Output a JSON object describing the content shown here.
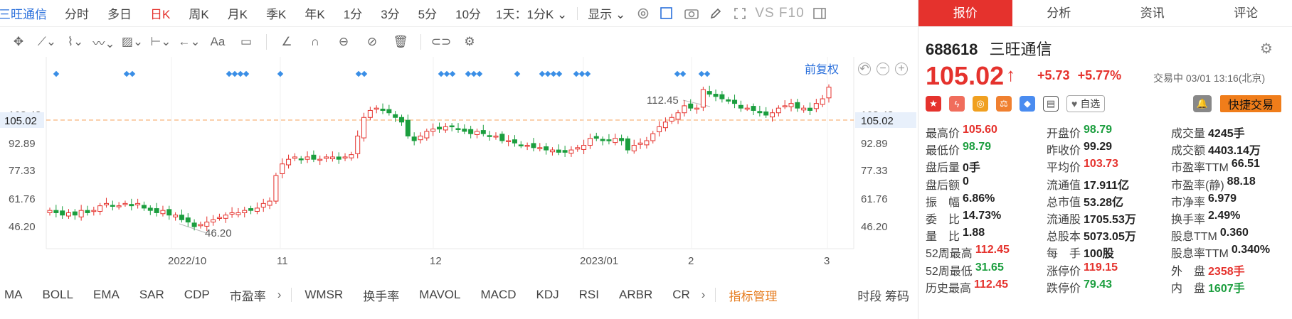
{
  "toolbar": {
    "stock_name": "三旺通信",
    "periods": [
      "分时",
      "多日",
      "日K",
      "周K",
      "月K",
      "季K",
      "年K",
      "1分",
      "3分",
      "5分",
      "10分"
    ],
    "active_period": "日K",
    "interval_select": "1天：1分K",
    "display_label": "显示",
    "vs_f10": "VS F10"
  },
  "chart": {
    "adjust_label": "前复权",
    "current_price_tag": "105.02",
    "max_annotation": "112.45",
    "min_annotation": "46.20",
    "y_ticks": [
      "108.43",
      "92.89",
      "77.33",
      "61.76",
      "46.20"
    ],
    "x_labels": [
      "2022/10",
      "11",
      "12",
      "2023/01",
      "2",
      "3"
    ]
  },
  "chart_data": {
    "type": "candlestick",
    "x_ticks": [
      "2022/10",
      "11",
      "12",
      "2023/01",
      "2",
      "3"
    ],
    "y_ticks": [
      46.2,
      61.76,
      77.33,
      92.89
    ],
    "ylim": [
      38,
      115
    ],
    "current_price": 105.02,
    "annotations": [
      {
        "label": "112.45",
        "kind": "high"
      },
      {
        "label": "46.20",
        "kind": "low"
      }
    ],
    "closes": [
      52,
      51,
      50,
      51,
      50,
      52,
      51,
      52,
      54,
      55,
      54,
      54,
      55,
      54,
      55,
      53,
      52,
      51,
      52,
      50,
      50,
      48,
      47,
      45,
      46,
      47,
      48,
      49,
      50,
      51,
      51,
      52,
      52,
      53,
      55,
      56,
      67,
      72,
      74,
      75,
      74,
      75,
      74,
      74,
      75,
      75,
      74,
      75,
      76,
      84,
      92,
      95,
      96,
      95,
      94,
      92,
      90,
      84,
      82,
      84,
      86,
      87,
      87,
      88,
      88,
      87,
      86,
      85,
      86,
      85,
      84,
      84,
      82,
      82,
      81,
      80,
      80,
      79,
      79,
      78,
      78,
      77,
      77,
      78,
      79,
      80,
      83,
      83,
      82,
      82,
      83,
      82,
      78,
      80,
      81,
      82,
      85,
      88,
      90,
      92,
      94,
      97,
      96,
      96,
      104,
      102,
      101,
      100,
      99,
      98,
      96,
      96,
      95,
      94,
      93,
      94,
      96,
      97,
      98,
      96,
      96,
      95,
      98,
      100,
      105
    ]
  },
  "indicators": {
    "items": [
      "MA",
      "BOLL",
      "EMA",
      "SAR",
      "CDP",
      "市盈率"
    ],
    "items2": [
      "WMSR",
      "换手率",
      "MAVOL",
      "MACD",
      "KDJ",
      "RSI",
      "ARBR",
      "CR"
    ],
    "manager": "指标管理",
    "right": "时段 筹码"
  },
  "panel": {
    "tabs": [
      "报价",
      "分析",
      "资讯",
      "评论"
    ],
    "code": "688618",
    "name": "三旺通信",
    "price": "105.02",
    "arrow": "↑",
    "change": "+5.73",
    "change_pct": "+5.77%",
    "status": "交易中 03/01 13:16(北京)",
    "watch_label": "自选",
    "quick_trade": "快捷交易",
    "rows": [
      [
        [
          "最高价",
          "105.60",
          "red"
        ],
        [
          "开盘价",
          "98.79",
          "green"
        ],
        [
          "成交量",
          "4245手",
          ""
        ]
      ],
      [
        [
          "最低价",
          "98.79",
          "green"
        ],
        [
          "昨收价",
          "99.29",
          ""
        ],
        [
          "成交额",
          "4403.14万",
          ""
        ]
      ],
      [
        [
          "盘后量",
          "0手",
          ""
        ],
        [
          "平均价",
          "103.73",
          "red"
        ],
        [
          "市盈率TTM",
          "66.51",
          ""
        ]
      ],
      [
        [
          "盘后额",
          "0",
          ""
        ],
        [
          "流通值",
          "17.911亿",
          ""
        ],
        [
          "市盈率(静)",
          "88.18",
          ""
        ]
      ],
      [
        [
          "振　幅",
          "6.86%",
          ""
        ],
        [
          "总市值",
          "53.28亿",
          ""
        ],
        [
          "市净率",
          "6.979",
          ""
        ]
      ],
      [
        [
          "委　比",
          "14.73%",
          ""
        ],
        [
          "流通股",
          "1705.53万",
          ""
        ],
        [
          "换手率",
          "2.49%",
          ""
        ]
      ],
      [
        [
          "量　比",
          "1.88",
          ""
        ],
        [
          "总股本",
          "5073.05万",
          ""
        ],
        [
          "股息TTM",
          "0.360",
          ""
        ]
      ],
      [
        [
          "52周最高",
          "112.45",
          "red"
        ],
        [
          "每　手",
          "100股",
          ""
        ],
        [
          "股息率TTM",
          "0.340%",
          ""
        ]
      ],
      [
        [
          "52周最低",
          "31.65",
          "green"
        ],
        [
          "涨停价",
          "119.15",
          "red"
        ],
        [
          "外　盘",
          "2358手",
          "red"
        ]
      ],
      [
        [
          "历史最高",
          "112.45",
          "red"
        ],
        [
          "跌停价",
          "79.43",
          "green"
        ],
        [
          "内　盘",
          "1607手",
          "green"
        ]
      ]
    ]
  }
}
